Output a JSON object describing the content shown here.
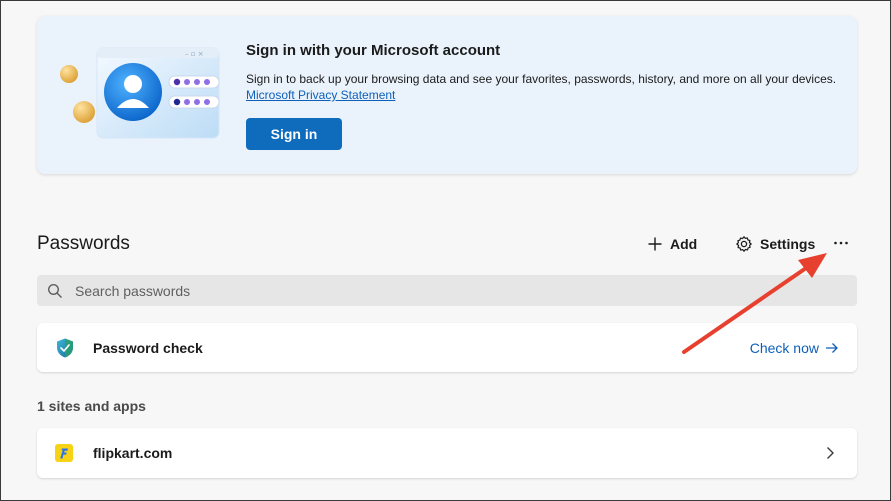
{
  "banner": {
    "title": "Sign in with your Microsoft account",
    "description": "Sign in to back up your browsing data and see your favorites, passwords, history, and more on all your devices.",
    "privacy_link": "Microsoft Privacy Statement",
    "signin_label": "Sign in"
  },
  "passwords": {
    "title": "Passwords",
    "add_label": "Add",
    "settings_label": "Settings",
    "more_label": "···",
    "search_placeholder": "Search passwords"
  },
  "password_check": {
    "label": "Password check",
    "action": "Check now"
  },
  "sites": {
    "heading": "1 sites and apps",
    "items": [
      {
        "label": "flipkart.com"
      }
    ]
  },
  "colors": {
    "accent": "#0f6cbd",
    "link": "#0f5fb8",
    "annotation": "#e8402f"
  }
}
